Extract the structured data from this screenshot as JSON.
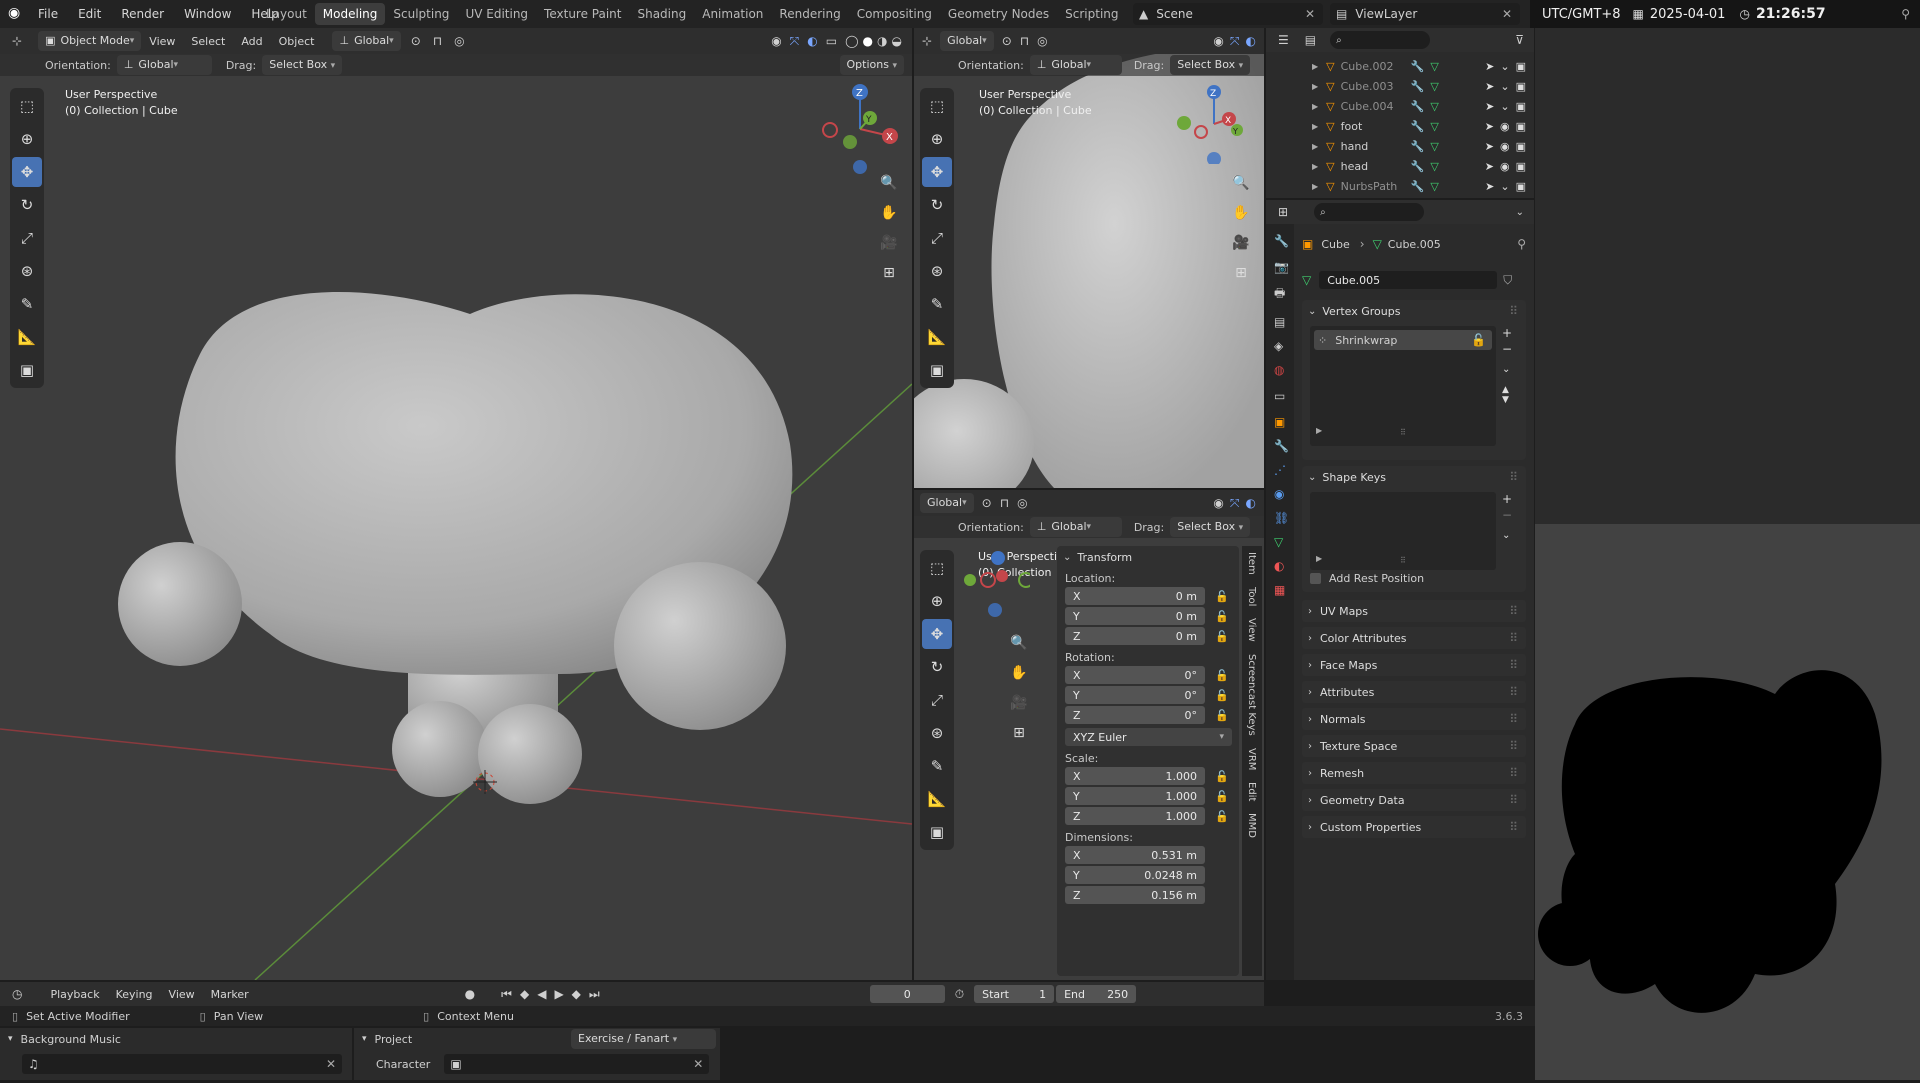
{
  "topbar": {
    "menus": [
      "File",
      "Edit",
      "Render",
      "Window",
      "Help"
    ],
    "workspaces": [
      "Layout",
      "Modeling",
      "Sculpting",
      "UV Editing",
      "Texture Paint",
      "Shading",
      "Animation",
      "Rendering",
      "Compositing",
      "Geometry Nodes",
      "Scripting"
    ],
    "active_workspace": "Modeling",
    "add_tab": "+",
    "scene": "Scene",
    "view_layer": "ViewLayer"
  },
  "clock": {
    "timezone": "UTC/GMT+8",
    "date": "2025-04-01",
    "time": "21:26:57"
  },
  "viewport_main": {
    "mode": "Object Mode",
    "menus": [
      "View",
      "Select",
      "Add",
      "Object"
    ],
    "transform_orientation": "Global",
    "orientation_label": "Orientation:",
    "orientation_value": "Global",
    "drag_label": "Drag:",
    "drag_value": "Select Box",
    "options": "Options",
    "perspective": "User Perspective",
    "collection": "(0) Collection | Cube"
  },
  "viewport_top_right": {
    "transform_orientation": "Global",
    "orientation_label": "Orientation:",
    "orientation_value": "Global",
    "drag_label": "Drag:",
    "drag_value": "Select Box",
    "perspective": "User Perspective",
    "collection": "(0) Collection | Cube"
  },
  "viewport_bottom_right": {
    "transform_orientation": "Global",
    "orientation_label": "Orientation:",
    "orientation_value": "Global",
    "drag_label": "Drag:",
    "drag_value": "Select Box",
    "perspective": "User Perspecti",
    "collection": "(0) Collection"
  },
  "transform_panel": {
    "title": "Transform",
    "location_label": "Location:",
    "location": [
      {
        "axis": "X",
        "value": "0 m"
      },
      {
        "axis": "Y",
        "value": "0 m"
      },
      {
        "axis": "Z",
        "value": "0 m"
      }
    ],
    "rotation_label": "Rotation:",
    "rotation": [
      {
        "axis": "X",
        "value": "0°"
      },
      {
        "axis": "Y",
        "value": "0°"
      },
      {
        "axis": "Z",
        "value": "0°"
      }
    ],
    "rotation_mode": "XYZ Euler",
    "scale_label": "Scale:",
    "scale": [
      {
        "axis": "X",
        "value": "1.000"
      },
      {
        "axis": "Y",
        "value": "1.000"
      },
      {
        "axis": "Z",
        "value": "1.000"
      }
    ],
    "dimensions_label": "Dimensions:",
    "dimensions": [
      {
        "axis": "X",
        "value": "0.531 m"
      },
      {
        "axis": "Y",
        "value": "0.0248 m"
      },
      {
        "axis": "Z",
        "value": "0.156 m"
      }
    ]
  },
  "side_tabs": [
    "Item",
    "Tool",
    "View",
    "Screencast Keys",
    "VRM",
    "Edit",
    "MMD"
  ],
  "outliner": {
    "items": [
      {
        "name": "Cube.002",
        "dim": true
      },
      {
        "name": "Cube.003",
        "dim": true
      },
      {
        "name": "Cube.004",
        "dim": true
      },
      {
        "name": "foot",
        "dim": false
      },
      {
        "name": "hand",
        "dim": false
      },
      {
        "name": "head",
        "dim": false
      },
      {
        "name": "NurbsPath",
        "dim": true
      }
    ]
  },
  "properties": {
    "breadcrumb_object": "Cube",
    "breadcrumb_data": "Cube.005",
    "data_name": "Cube.005",
    "vertex_groups_title": "Vertex Groups",
    "vertex_group_item": "Shrinkwrap",
    "shape_keys_title": "Shape Keys",
    "add_rest_position": "Add Rest Position",
    "collapsed_sections": [
      "UV Maps",
      "Color Attributes",
      "Face Maps",
      "Attributes",
      "Normals",
      "Texture Space",
      "Remesh",
      "Geometry Data",
      "Custom Properties"
    ]
  },
  "timeline": {
    "menus": [
      "Playback",
      "Keying",
      "View",
      "Marker"
    ],
    "current_frame": "0",
    "start_label": "Start",
    "start": "1",
    "end_label": "End",
    "end": "250"
  },
  "statusbar": {
    "left": "Set Active Modifier",
    "middle": "Pan View",
    "right": "Context Menu",
    "version": "3.6.3"
  },
  "bottom_panels": {
    "bgm_title": "Background Music",
    "project_label": "Project",
    "project_value": "Exercise / Fanart",
    "character_label": "Character"
  },
  "colors": {
    "accent": "#4772b3",
    "viewport_bg": "#3d3d3d",
    "x_axis": "#c4464a",
    "y_axis": "#6ea83a",
    "z_axis": "#3f73c4"
  }
}
